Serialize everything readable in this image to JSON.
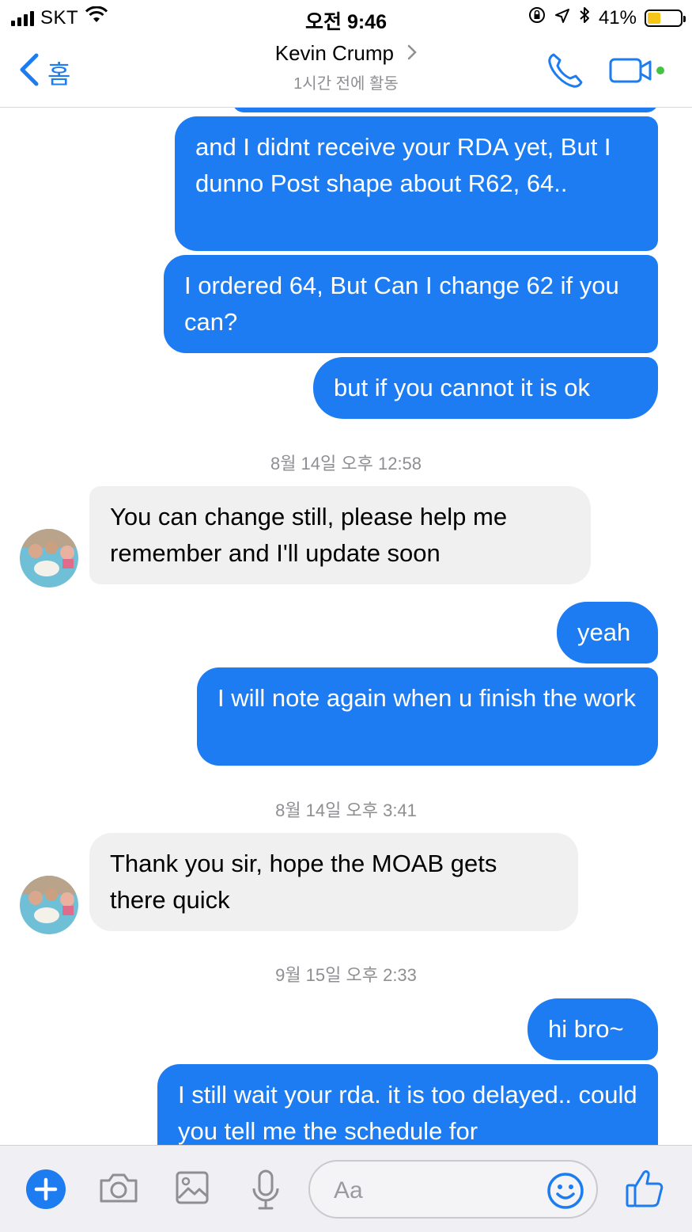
{
  "status_bar": {
    "carrier": "SKT",
    "time": "오전 9:46",
    "battery_text": "41%",
    "battery_level": 0.41,
    "icons": [
      "signal-icon",
      "wifi-icon",
      "orientation-lock-icon",
      "location-icon",
      "bluetooth-icon",
      "battery-icon"
    ]
  },
  "header": {
    "back_label": "홈",
    "contact_name": "Kevin Crump",
    "active_status": "1시간 전에 활동",
    "icons": [
      "back-chevron-icon",
      "chevron-right-icon",
      "phone-icon",
      "video-camera-icon"
    ],
    "online_color": "#44c244"
  },
  "colors": {
    "outgoing": "#1e7cf2",
    "incoming": "#f0f0f0",
    "accent": "#1c7cf0"
  },
  "messages": [
    {
      "from": "me",
      "text": ""
    },
    {
      "from": "me",
      "text": "and I didnt receive your RDA yet, But I dunno Post shape about R62, 64.."
    },
    {
      "from": "me",
      "text": "I ordered 64, But Can I change 62 if you can?"
    },
    {
      "from": "me",
      "text": "but if you cannot it is ok"
    },
    {
      "timestamp": "8월 14일 오후 12:58"
    },
    {
      "from": "Kevin Crump",
      "text": "You can change still, please help me remember and I'll update soon"
    },
    {
      "from": "me",
      "text": "yeah"
    },
    {
      "from": "me",
      "text": "I will note again when u finish the work"
    },
    {
      "timestamp": "8월 14일 오후 3:41"
    },
    {
      "from": "Kevin Crump",
      "text": "Thank you sir, hope the MOAB gets there quick"
    },
    {
      "timestamp": "9월 15일 오후 2:33"
    },
    {
      "from": "me",
      "text": "hi bro~"
    },
    {
      "from": "me",
      "text": "I still wait your rda. it is too delayed.. could you tell me the schedule for"
    }
  ],
  "composer": {
    "placeholder": "Aa",
    "icons": [
      "plus-icon",
      "camera-icon",
      "image-icon",
      "microphone-icon",
      "emoji-icon",
      "thumbs-up-icon"
    ]
  }
}
